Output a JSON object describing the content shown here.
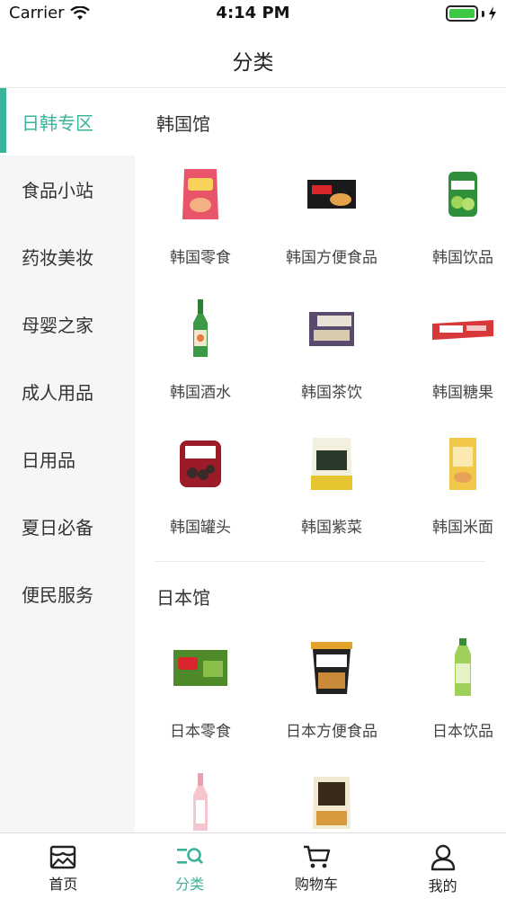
{
  "status": {
    "carrier": "Carrier",
    "time": "4:14 PM"
  },
  "nav": {
    "title": "分类"
  },
  "sidebar": {
    "items": [
      {
        "label": "日韩专区",
        "active": true
      },
      {
        "label": "食品小站"
      },
      {
        "label": "药妆美妆"
      },
      {
        "label": "母婴之家"
      },
      {
        "label": "成人用品"
      },
      {
        "label": "日用品"
      },
      {
        "label": "夏日必备"
      },
      {
        "label": "便民服务"
      }
    ]
  },
  "sections": [
    {
      "title": "韩国馆",
      "items": [
        {
          "label": "韩国零食"
        },
        {
          "label": "韩国方便食品"
        },
        {
          "label": "韩国饮品"
        },
        {
          "label": "韩国酒水"
        },
        {
          "label": "韩国茶饮"
        },
        {
          "label": "韩国糖果"
        },
        {
          "label": "韩国罐头"
        },
        {
          "label": "韩国紫菜"
        },
        {
          "label": "韩国米面"
        }
      ]
    },
    {
      "title": "日本馆",
      "items": [
        {
          "label": "日本零食"
        },
        {
          "label": "日本方便食品"
        },
        {
          "label": "日本饮品"
        },
        {
          "label": ""
        },
        {
          "label": ""
        }
      ]
    }
  ],
  "tabs": [
    {
      "label": "首页"
    },
    {
      "label": "分类",
      "active": true
    },
    {
      "label": "购物车"
    },
    {
      "label": "我的"
    }
  ],
  "colors": {
    "accent": "#3bb39a",
    "battery": "#3cc843"
  }
}
